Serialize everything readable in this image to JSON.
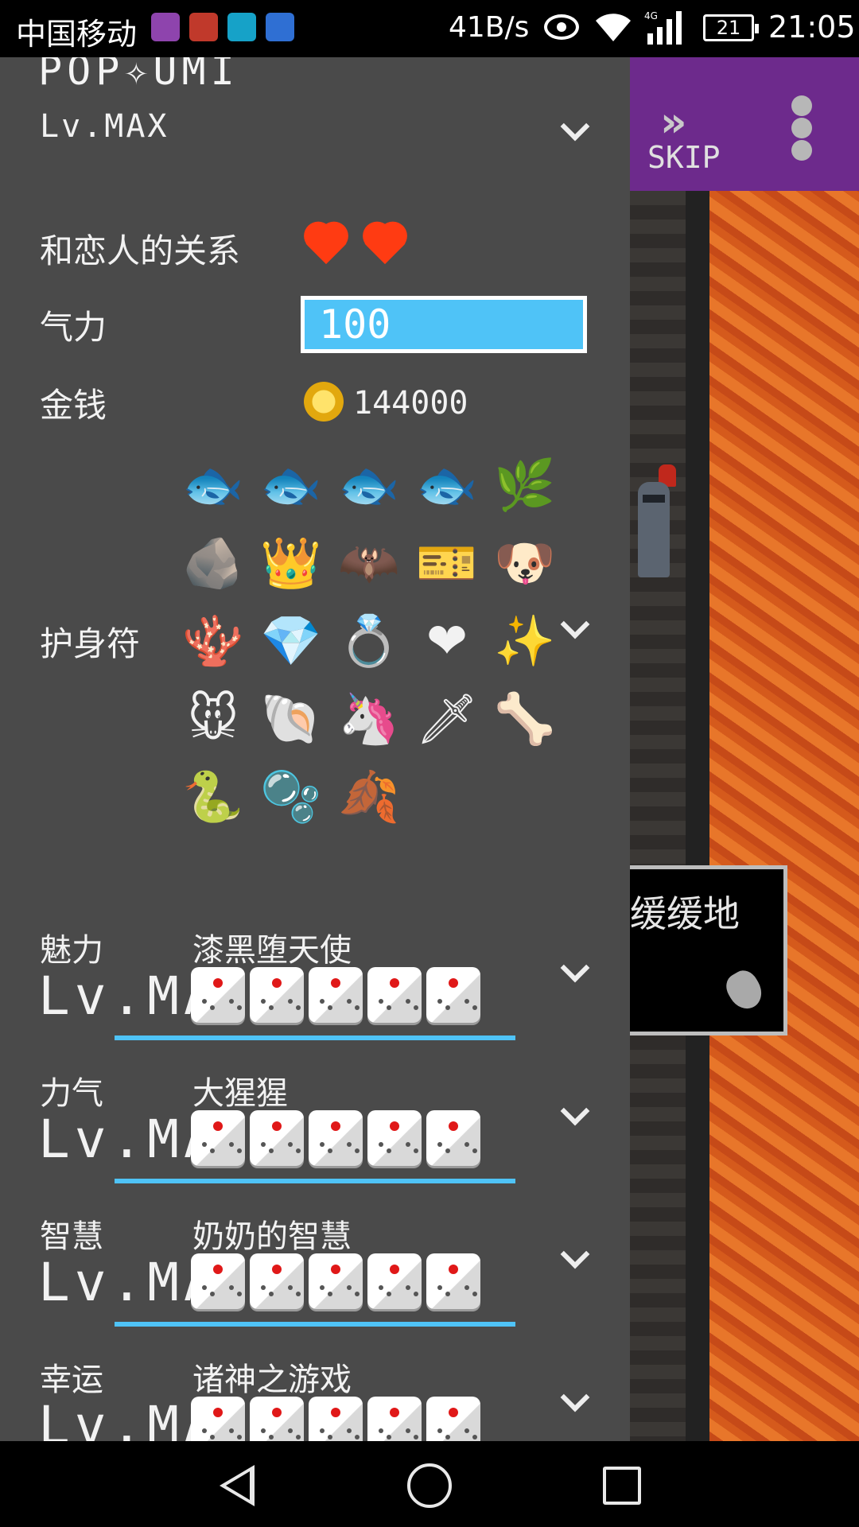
{
  "status_bar": {
    "carrier": "中国移动",
    "net_speed": "41B/s",
    "network": "4G",
    "battery": "21",
    "time": "21:05"
  },
  "top_bar": {
    "skip_label": "SKIP"
  },
  "character": {
    "name": "POP✧UMI",
    "level": "Lv.MAX"
  },
  "relationship": {
    "label": "和恋人的关系",
    "hearts": 2
  },
  "stamina": {
    "label": "气力",
    "value": "100",
    "fill_fraction": 1.0
  },
  "money": {
    "label": "金钱",
    "value": "144000"
  },
  "amulets": {
    "label": "护身符",
    "items": [
      {
        "icon": "fish-icon",
        "glyph": "🐟"
      },
      {
        "icon": "tuna-icon",
        "glyph": "🐟"
      },
      {
        "icon": "fish-icon",
        "glyph": "🐟"
      },
      {
        "icon": "fish-icon",
        "glyph": "🐟"
      },
      {
        "icon": "branch-icon",
        "glyph": "🌿"
      },
      {
        "icon": "fossil-stone-icon",
        "glyph": "🪨"
      },
      {
        "icon": "crown-icon",
        "glyph": "👑"
      },
      {
        "icon": "bat-icon",
        "glyph": "🦇"
      },
      {
        "icon": "ticket-icon",
        "glyph": "🎫"
      },
      {
        "icon": "plush-dog-icon",
        "glyph": "🐶"
      },
      {
        "icon": "coral-icon",
        "glyph": "🪸"
      },
      {
        "icon": "tiara-icon",
        "glyph": "💎"
      },
      {
        "icon": "gold-ring-icon",
        "glyph": "💍"
      },
      {
        "icon": "red-pendant-icon",
        "glyph": "❤"
      },
      {
        "icon": "magic-wand-icon",
        "glyph": "✨"
      },
      {
        "icon": "mouse-icon",
        "glyph": "🐭"
      },
      {
        "icon": "ammonite-icon",
        "glyph": "🐚"
      },
      {
        "icon": "horn-icon",
        "glyph": "🦄"
      },
      {
        "icon": "sword-icon",
        "glyph": "🗡"
      },
      {
        "icon": "bone-icon",
        "glyph": "🦴"
      },
      {
        "icon": "snake-icon",
        "glyph": "🐍"
      },
      {
        "icon": "pink-slime-icon",
        "glyph": "🫧"
      },
      {
        "icon": "leaf-icon",
        "glyph": "🍂"
      }
    ]
  },
  "stats": [
    {
      "label": "魅力",
      "title": "漆黑堕天使",
      "level": "Lv.MAX",
      "dice": 5
    },
    {
      "label": "力气",
      "title": "大猩猩",
      "level": "Lv.MAX",
      "dice": 5
    },
    {
      "label": "智慧",
      "title": "奶奶的智慧",
      "level": "Lv.MAX",
      "dice": 5
    },
    {
      "label": "幸运",
      "title": "诸神之游戏",
      "level": "Lv.MAX",
      "dice": 5
    }
  ],
  "dialog": {
    "text": "缓缓地"
  },
  "colors": {
    "drawer_bg": "#4a4a4a",
    "accent": "#4fc3f7",
    "top_bar": "#6d2a8c",
    "heart": "#ff3b12",
    "lava": "#d6601f"
  }
}
